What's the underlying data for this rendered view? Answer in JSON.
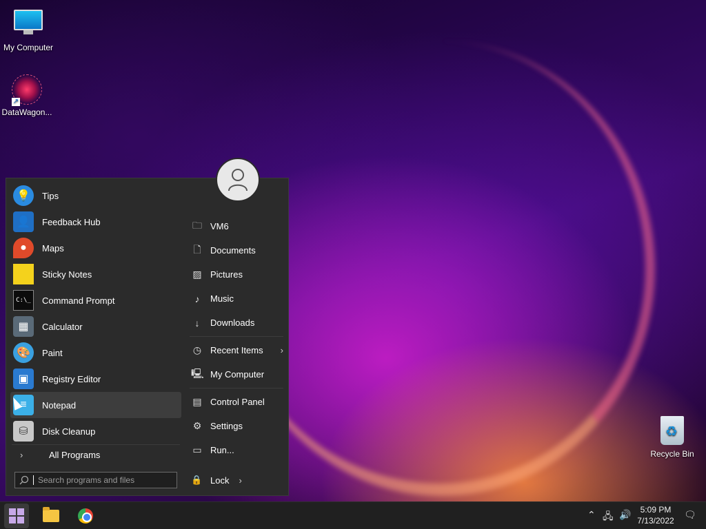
{
  "desktop": {
    "icons": [
      {
        "label": "My Computer",
        "icon": "monitor-icon"
      },
      {
        "label": "DataWagon...",
        "icon": "datawagon-icon"
      },
      {
        "label": "Recycle Bin",
        "icon": "recycle-bin-icon"
      }
    ]
  },
  "start_menu": {
    "user_icon": "user-avatar-icon",
    "apps": [
      {
        "label": "Tips",
        "icon": "lightbulb-icon",
        "color": "#2a8be0"
      },
      {
        "label": "Feedback Hub",
        "icon": "feedback-icon",
        "color": "#1f6fc4"
      },
      {
        "label": "Maps",
        "icon": "map-pin-icon",
        "color": "#e04a2a"
      },
      {
        "label": "Sticky Notes",
        "icon": "sticky-note-icon",
        "color": "#f4d21c"
      },
      {
        "label": "Command Prompt",
        "icon": "terminal-icon",
        "color": "#0c0c0c"
      },
      {
        "label": "Calculator",
        "icon": "calculator-icon",
        "color": "#5a6a78"
      },
      {
        "label": "Paint",
        "icon": "palette-icon",
        "color": "#3aa0e0"
      },
      {
        "label": "Registry Editor",
        "icon": "registry-icon",
        "color": "#2a7ad0"
      },
      {
        "label": "Notepad",
        "icon": "notepad-icon",
        "color": "#3bb0e8"
      },
      {
        "label": "Disk Cleanup",
        "icon": "disk-cleanup-icon",
        "color": "#c8c8c8"
      }
    ],
    "all_programs_label": "All Programs",
    "search_placeholder": "Search programs and files",
    "places": [
      {
        "label": "VM6",
        "icon": "user-folder-icon"
      },
      {
        "label": "Documents",
        "icon": "document-icon"
      },
      {
        "label": "Pictures",
        "icon": "picture-icon"
      },
      {
        "label": "Music",
        "icon": "music-icon"
      },
      {
        "label": "Downloads",
        "icon": "download-icon"
      },
      {
        "label": "Recent Items",
        "icon": "clock-icon",
        "has_submenu": true
      },
      {
        "label": "My Computer",
        "icon": "computer-icon"
      },
      {
        "label": "Control Panel",
        "icon": "control-panel-icon"
      },
      {
        "label": "Settings",
        "icon": "gear-icon"
      },
      {
        "label": "Run...",
        "icon": "run-icon"
      }
    ],
    "lock_label": "Lock"
  },
  "taskbar": {
    "clock_time": "5:09 PM",
    "clock_date": "7/13/2022"
  }
}
